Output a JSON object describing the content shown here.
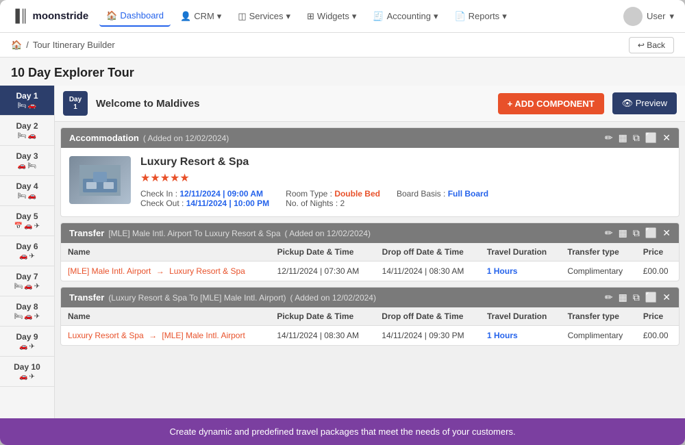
{
  "app": {
    "logo": "moonstride",
    "logo_icon": "|||"
  },
  "topnav": {
    "items": [
      {
        "label": "Dashboard",
        "icon": "home",
        "active": true
      },
      {
        "label": "CRM",
        "icon": "person",
        "dropdown": true
      },
      {
        "label": "Services",
        "icon": "layers",
        "dropdown": true
      },
      {
        "label": "Widgets",
        "icon": "grid",
        "dropdown": true
      },
      {
        "label": "Accounting",
        "icon": "receipt",
        "dropdown": true
      },
      {
        "label": "Reports",
        "icon": "file",
        "dropdown": true
      }
    ],
    "user_label": "User"
  },
  "breadcrumb": {
    "home_icon": "🏠",
    "separator": "/",
    "current": "Tour Itinerary Builder",
    "back_label": "↩ Back"
  },
  "page": {
    "title": "10 Day Explorer Tour"
  },
  "sidebar": {
    "days": [
      {
        "label": "Day 1",
        "num": 1,
        "icons": [
          "🛏",
          "🚗"
        ],
        "active": true
      },
      {
        "label": "Day 2",
        "num": 2,
        "icons": [
          "🛏",
          "🚗"
        ]
      },
      {
        "label": "Day 3",
        "num": 3,
        "icons": [
          "🚗",
          "🛏"
        ]
      },
      {
        "label": "Day 4",
        "num": 4,
        "icons": [
          "🛏",
          "🚗"
        ]
      },
      {
        "label": "Day 5",
        "num": 5,
        "icons": [
          "📅",
          "🚗",
          "✈"
        ]
      },
      {
        "label": "Day 6",
        "num": 6,
        "icons": [
          "🚗",
          "✈"
        ]
      },
      {
        "label": "Day 7",
        "num": 7,
        "icons": [
          "🛏",
          "🚗",
          "✈"
        ]
      },
      {
        "label": "Day 8",
        "num": 8,
        "icons": [
          "🛏",
          "🚗",
          "✈"
        ]
      },
      {
        "label": "Day 9",
        "num": 9,
        "icons": [
          "🚗",
          "✈"
        ]
      },
      {
        "label": "Day 10",
        "num": 10,
        "icons": [
          "🚗",
          "✈"
        ]
      }
    ]
  },
  "day_header": {
    "day_label": "Day",
    "day_num": "1",
    "title": "Welcome to Maldives",
    "add_component_label": "+ ADD COMPONENT",
    "preview_label": "👁 Preview"
  },
  "accommodation": {
    "section_label": "Accommodation",
    "added_date": "( Added on 12/02/2024)",
    "name": "Luxury Resort & Spa",
    "stars": "★★★★★",
    "check_in_label": "Check In :",
    "check_in_val": "12/11/2024 | 09:00 AM",
    "check_out_label": "Check Out :",
    "check_out_val": "14/11/2024 | 10:00 PM",
    "room_type_label": "Room Type :",
    "room_type_val": "Double Bed",
    "nights_label": "No. of Nights :",
    "nights_val": "2",
    "board_basis_label": "Board Basis :",
    "board_basis_val": "Full Board"
  },
  "transfer1": {
    "section_label": "Transfer",
    "route": "(IMLE] Male Intl. Airport To Luxury Resort & Spa)",
    "added_date": "( Added on 12/02/2024)",
    "columns": [
      "Name",
      "Pickup Date & Time",
      "Drop off Date & Time",
      "Travel Duration",
      "Transfer type",
      "Price"
    ],
    "rows": [
      {
        "name_from": "[MLE] Male Intl. Airport",
        "name_to": "Luxury Resort & Spa",
        "pickup": "12/11/2024 | 07:30 AM",
        "dropoff": "14/11/2024 | 08:30 AM",
        "duration": "1 Hours",
        "type": "Complimentary",
        "price": "£00.00"
      }
    ]
  },
  "transfer2": {
    "section_label": "Transfer",
    "route": "(Luxury Resort & Spa To [MLE] Male Intl. Airport)",
    "added_date": "( Added on 12/02/2024)",
    "columns": [
      "Name",
      "Pickup Date & Time",
      "Drop off Date & Time",
      "Travel Duration",
      "Transfer type",
      "Price"
    ],
    "rows": [
      {
        "name_from": "Luxury Resort & Spa",
        "name_to": "[MLE] Male Intl. Airport",
        "pickup": "14/11/2024 | 08:30 AM",
        "dropoff": "14/11/2024 | 09:30 PM",
        "duration": "1 Hours",
        "type": "Complimentary",
        "price": "£00.00"
      }
    ]
  },
  "footer": {
    "text": "Create dynamic and predefined travel packages that meet the needs of your customers."
  },
  "colors": {
    "accent_orange": "#e8512a",
    "accent_blue": "#2563eb",
    "nav_dark": "#2c3e6b",
    "purple": "#7b3fa0",
    "grey_header": "#7a7a7a"
  }
}
